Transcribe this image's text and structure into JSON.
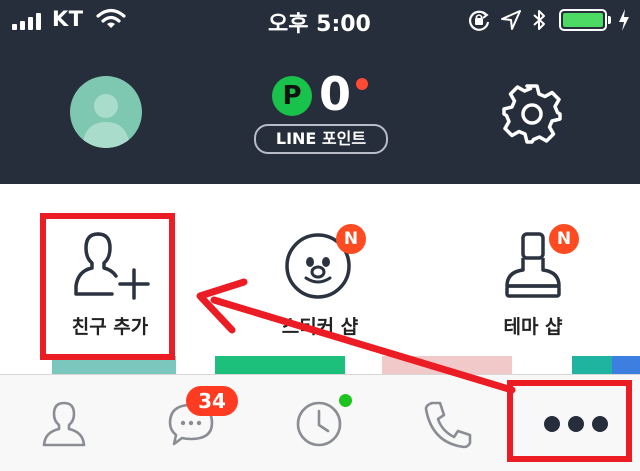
{
  "status_bar": {
    "carrier": "KT",
    "time": "오후 5:00",
    "battery_color": "#4cd964"
  },
  "header": {
    "avatar_icon": "profile-placeholder-icon",
    "points": {
      "badge": "P",
      "value": "0",
      "label": "LINE 포인트"
    },
    "settings_icon": "gear-icon"
  },
  "menu": {
    "items": [
      {
        "label": "친구 추가",
        "icon": "add-friend-icon",
        "badge": ""
      },
      {
        "label": "스티커 샵",
        "icon": "sticker-face-icon",
        "badge": "N"
      },
      {
        "label": "테마 샵",
        "icon": "theme-stamp-icon",
        "badge": "N"
      }
    ]
  },
  "tabbar": {
    "tabs": [
      {
        "icon": "friends-icon"
      },
      {
        "icon": "chat-bubble-icon",
        "badge": "34"
      },
      {
        "icon": "clock-icon",
        "dot_color": "#1ec31e"
      },
      {
        "icon": "phone-icon"
      },
      {
        "icon": "more-dots-icon"
      }
    ]
  },
  "colors": {
    "header_bg": "#262d3b",
    "highlight": "#ec1c24",
    "badge_red": "#ff4b22",
    "point_green": "#19c34b"
  }
}
